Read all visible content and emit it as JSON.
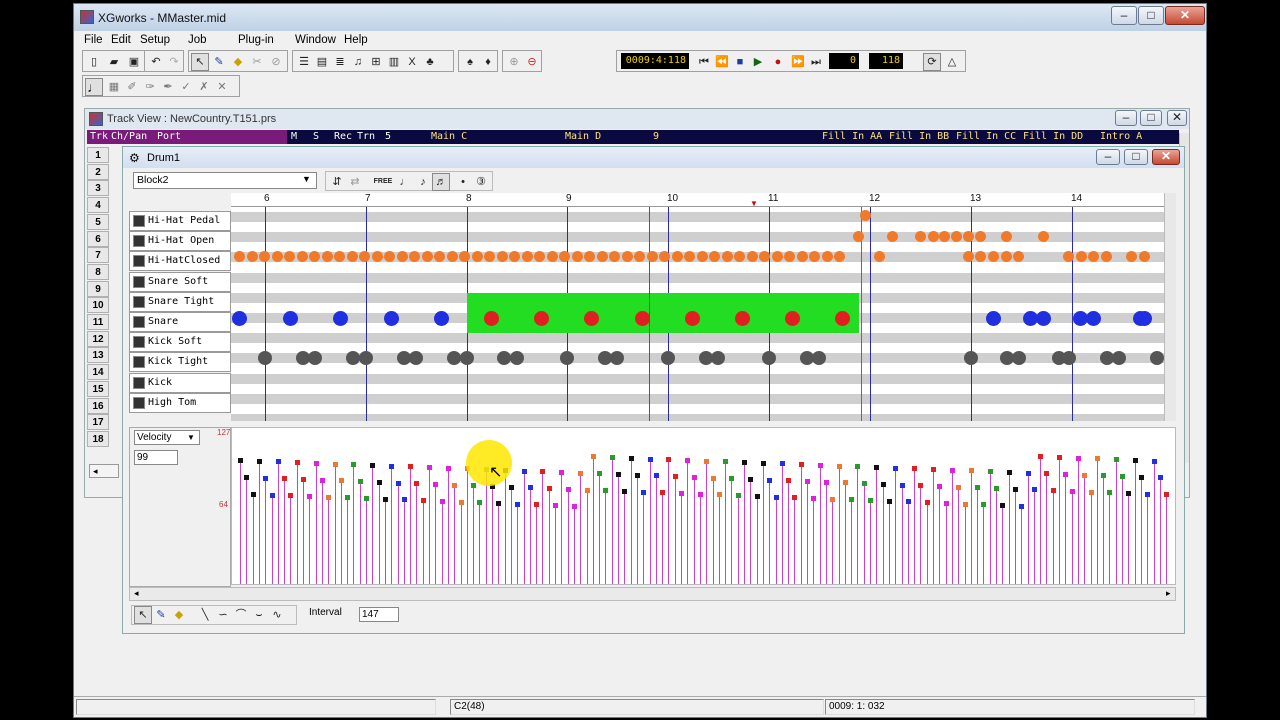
{
  "app": {
    "title": "XGworks - MMaster.mid"
  },
  "menu": [
    "File",
    "Edit",
    "Setup",
    "Job",
    "Plug-in",
    "Window",
    "Help"
  ],
  "transport": {
    "position": "0009:4:118",
    "key": "0",
    "tempo": "118"
  },
  "track_view": {
    "title": "Track View : NewCountry.T151.prs",
    "headers": {
      "trk": "Trk",
      "chpan": "Ch/Pan",
      "port": "Port",
      "m": "M",
      "s": "S",
      "rec": "Rec",
      "trn": "Trn"
    },
    "measure_first": "5",
    "markers": [
      "Main C",
      "Main D",
      "9",
      "Fill In AA",
      "Fill In BB",
      "Fill In CC",
      "Fill In DD",
      "Intro A"
    ],
    "track_numbers": [
      "1",
      "2",
      "3",
      "4",
      "5",
      "6",
      "7",
      "8",
      "9",
      "10",
      "11",
      "12",
      "13",
      "14",
      "15",
      "16",
      "17",
      "18"
    ]
  },
  "drum_window": {
    "title": "Drum1",
    "block_select": "Block2",
    "free_label": "FREE",
    "ruler_labels": [
      "6",
      "7",
      "8",
      "9",
      "10",
      "11",
      "12",
      "13",
      "14"
    ],
    "instruments": [
      "Hi-Hat Pedal",
      "Hi-Hat Open",
      "Hi-HatClosed",
      "Snare Soft",
      "Snare Tight",
      "Snare",
      "Kick Soft",
      "Kick Tight",
      "Kick",
      "High Tom"
    ],
    "velocity": {
      "mode": "Velocity",
      "value": "99",
      "max_label": "127",
      "mid_label": "64"
    },
    "interval_label": "Interval",
    "interval_value": "147"
  },
  "status": {
    "note": "C2(48)",
    "position": "0009: 1: 032"
  },
  "colors": {
    "hihat": "#f07a2a",
    "snare": "#2030e0",
    "snare_selected": "#e02020",
    "kick": "#555555",
    "selection": "#22dd22",
    "velocity_line": "#d040d0"
  }
}
